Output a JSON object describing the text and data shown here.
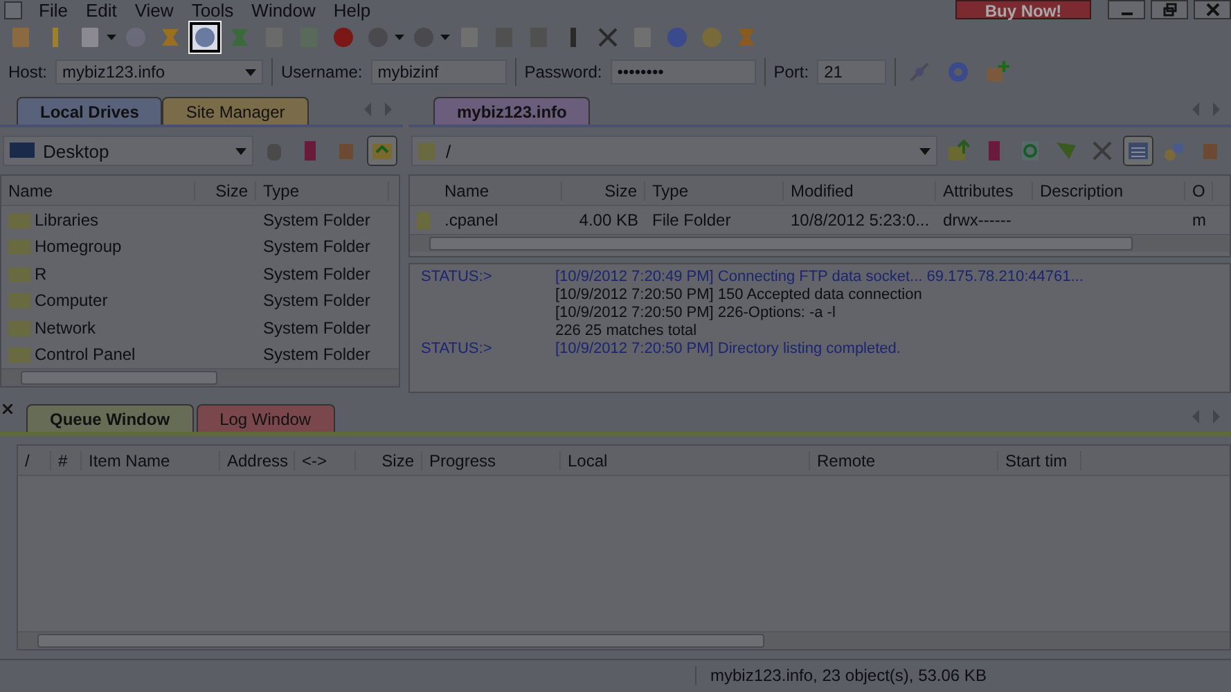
{
  "menu": [
    "File",
    "Edit",
    "View",
    "Tools",
    "Window",
    "Help"
  ],
  "buy_button": "Buy Now!",
  "toolbar": [
    {
      "highlighted": false
    },
    {
      "highlighted": false
    },
    {
      "highlighted": false
    },
    {
      "highlighted": false
    },
    {
      "highlighted": false
    },
    {
      "highlighted": true
    },
    {
      "highlighted": false
    },
    {
      "highlighted": false
    },
    {
      "highlighted": false
    },
    {
      "highlighted": false
    },
    {
      "highlighted": false
    },
    {
      "highlighted": false
    },
    {
      "highlighted": false
    },
    {
      "highlighted": false
    },
    {
      "highlighted": false
    },
    {
      "highlighted": false
    },
    {
      "highlighted": false
    },
    {
      "highlighted": false
    },
    {
      "highlighted": false
    },
    {
      "highlighted": false
    },
    {
      "highlighted": false
    }
  ],
  "connection": {
    "host_label": "Host:",
    "host": "mybiz123.info",
    "username_label": "Username:",
    "username": "mybizinf",
    "password_label": "Password:",
    "password": "••••••••",
    "port_label": "Port:",
    "port": "21"
  },
  "local": {
    "tabs": [
      {
        "label": "Local Drives",
        "selected": true
      },
      {
        "label": "Site Manager",
        "selected": false
      }
    ],
    "path": "Desktop",
    "columns": [
      "Name",
      "Size",
      "Type"
    ],
    "rows": [
      {
        "name": "Libraries",
        "size": "",
        "type": "System Folder"
      },
      {
        "name": "Homegroup",
        "size": "",
        "type": "System Folder"
      },
      {
        "name": "R",
        "size": "",
        "type": "System Folder"
      },
      {
        "name": "Computer",
        "size": "",
        "type": "System Folder"
      },
      {
        "name": "Network",
        "size": "",
        "type": "System Folder"
      },
      {
        "name": "Control Panel",
        "size": "",
        "type": "System Folder"
      }
    ]
  },
  "remote": {
    "tabs": [
      {
        "label": "mybiz123.info",
        "selected": true
      }
    ],
    "path": "/",
    "columns": [
      "Name",
      "Size",
      "Type",
      "Modified",
      "Attributes",
      "Description",
      "O"
    ],
    "rows": [
      {
        "name": ".cpanel",
        "size": "4.00 KB",
        "type": "File Folder",
        "modified": "10/8/2012 5:23:0...",
        "attributes": "drwx------",
        "description": "",
        "column_7": "m"
      }
    ],
    "log": [
      {
        "kind": "status",
        "label": "STATUS:>",
        "text": "[10/9/2012 7:20:49 PM] Connecting FTP data socket... 69.175.78.210:44761..."
      },
      {
        "kind": "plain",
        "text": "[10/9/2012 7:20:50 PM] 150 Accepted data connection"
      },
      {
        "kind": "plain",
        "text": "[10/9/2012 7:20:50 PM] 226-Options: -a -l"
      },
      {
        "kind": "plain",
        "text": "226 25 matches total"
      },
      {
        "kind": "status",
        "label": "STATUS:>",
        "text": "[10/9/2012 7:20:50 PM] Directory listing completed."
      }
    ]
  },
  "queue": {
    "tabs": [
      {
        "label": "Queue Window",
        "selected": true
      },
      {
        "label": "Log Window",
        "selected": false
      }
    ],
    "columns": [
      "/",
      "#",
      "Item Name",
      "Address",
      "<->",
      "Size",
      "Progress",
      "Local",
      "Remote",
      "Start tim"
    ]
  },
  "status_bar": "mybiz123.info, 23 object(s), 53.06 KB"
}
